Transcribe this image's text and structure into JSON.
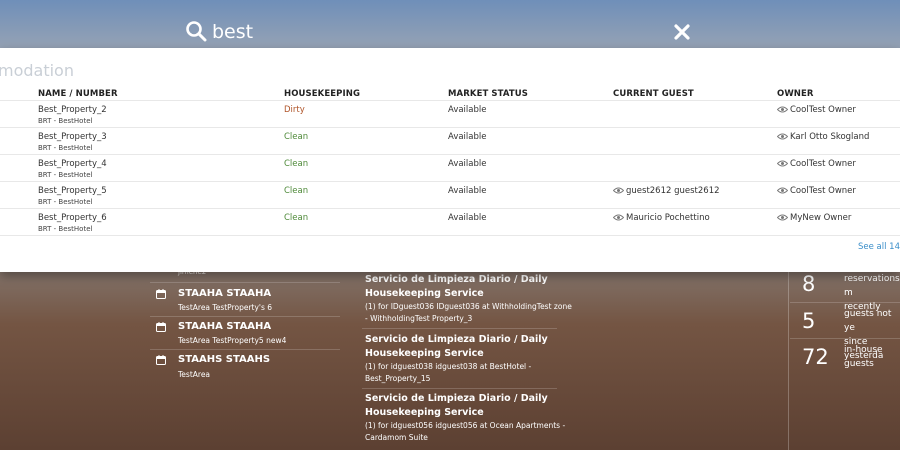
{
  "search": {
    "query": "best"
  },
  "results": {
    "section_title": "modation",
    "columns": [
      "NAME / NUMBER",
      "HOUSEKEEPING",
      "MARKET STATUS",
      "CURRENT GUEST",
      "OWNER"
    ],
    "rows": [
      {
        "name": "Best_Property_2",
        "sub": "BRT - BestHotel",
        "housekeeping": "Dirty",
        "market": "Available",
        "guest": "",
        "owner": "CoolTest Owner"
      },
      {
        "name": "Best_Property_3",
        "sub": "BRT - BestHotel",
        "housekeeping": "Clean",
        "market": "Available",
        "guest": "",
        "owner": "Karl Otto Skogland"
      },
      {
        "name": "Best_Property_4",
        "sub": "BRT - BestHotel",
        "housekeeping": "Clean",
        "market": "Available",
        "guest": "",
        "owner": "CoolTest Owner"
      },
      {
        "name": "Best_Property_5",
        "sub": "BRT - BestHotel",
        "housekeeping": "Clean",
        "market": "Available",
        "guest": "guest2612 guest2612",
        "owner": "CoolTest Owner"
      },
      {
        "name": "Best_Property_6",
        "sub": "BRT - BestHotel",
        "housekeeping": "Clean",
        "market": "Available",
        "guest": "Mauricio Pochettino",
        "owner": "MyNew Owner"
      }
    ],
    "see_all": "See all 14"
  },
  "background": {
    "left_list": [
      {
        "peek": "jimene2"
      },
      {
        "title": "STAAHA STAAHA",
        "sub": "TestArea TestProperty's 6"
      },
      {
        "title": "STAAHA STAAHA",
        "sub": "TestArea TestProperty5 new4"
      },
      {
        "title": "STAAHS STAAHS",
        "sub": "TestArea"
      }
    ],
    "tasks": [
      {
        "title1": "Servicio de Limpieza Diario / Daily",
        "title2": "Housekeeping Service",
        "detail1": "(1) for IDguest036 IDguest036 at WithholdingTest zone",
        "detail2": "- WithholdingTest Property_3"
      },
      {
        "title1": "Servicio de Limpieza Diario / Daily",
        "title2": "Housekeeping Service",
        "detail1": "(1) for idguest038 idguest038 at BestHotel -",
        "detail2": "Best_Property_15"
      },
      {
        "title1": "Servicio de Limpieza Diario / Daily",
        "title2": "Housekeeping Service",
        "detail1": "(1) for idguest056 idguest056 at Ocean Apartments -",
        "detail2": "Cardamom Suite"
      }
    ],
    "stats": [
      {
        "value": "8",
        "line1": "reservations m",
        "line2": "recently"
      },
      {
        "value": "5",
        "line1": "guests not ye",
        "line2": "since yesterda"
      },
      {
        "value": "72",
        "line1": "in-house",
        "line2": "guests"
      }
    ]
  }
}
